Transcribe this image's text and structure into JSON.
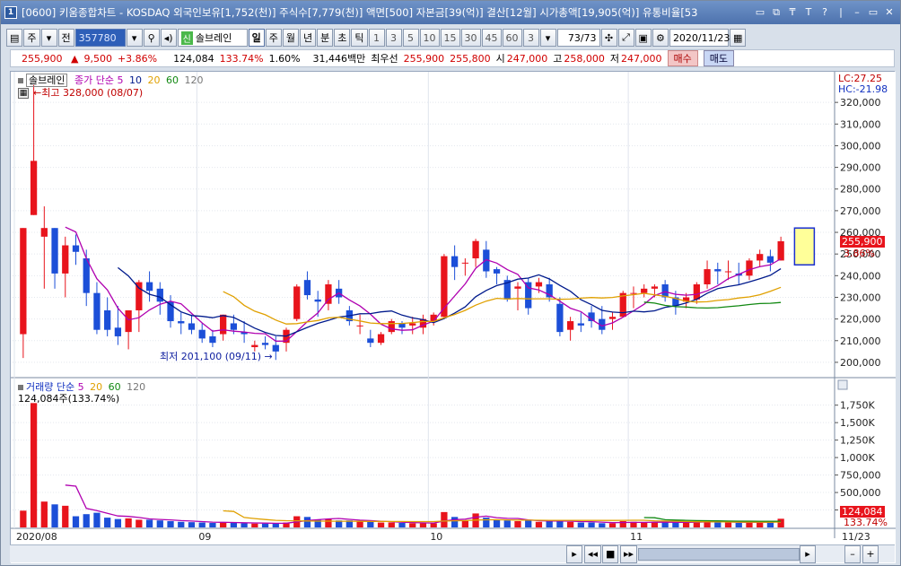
{
  "title": {
    "text": "[0600] 키움종합차트 - KOSDAQ 외국인보유[1,752(천)] 주식수[7,779(천)] 액면[500] 자본금[39(억)] 결산[12월] 시가총액[19,905(억)] 유통비율[53",
    "icon_label": "1"
  },
  "window_controls": [
    "▭",
    "⧉",
    "₸",
    "T",
    "?",
    "|",
    "–",
    "▭",
    "✕"
  ],
  "toolbar": {
    "period_label": "주",
    "prev_label": "전",
    "code": "357780",
    "search_icon": "magnifier-icon",
    "sound_icon": "speaker-icon",
    "new_tag": "신",
    "stock_name": "솔브레인",
    "periods": [
      "일",
      "주",
      "월",
      "년",
      "분",
      "초",
      "틱"
    ],
    "active_period": "일",
    "intervals": [
      "1",
      "3",
      "5",
      "10",
      "15",
      "30",
      "45",
      "60"
    ],
    "interval_value": "3",
    "count": "73",
    "count_total": "/73",
    "date": "2020/11/23"
  },
  "quote": {
    "price": "255,900",
    "arrow": "▲",
    "change": "9,500",
    "change_pct": "+3.86%",
    "volume": "124,084",
    "volume_ratio": "133.74%",
    "turnover": "1.60%",
    "amount": "31,446백만",
    "best_label": "최우선",
    "best_sell": "255,900",
    "best_buy": "255,800",
    "open_label": "시",
    "open": "247,000",
    "high_label": "고",
    "high": "258,000",
    "low_label": "저",
    "low": "247,000",
    "buy_label": "매수",
    "sell_label": "매도"
  },
  "price_panel": {
    "stock_tag": "솔브레인",
    "ma_label": "종가 단순",
    "ma_periods": [
      "5",
      "10",
      "20",
      "60",
      "120"
    ],
    "high_note": "←최고 328,000 (08/07)",
    "low_note": "최저 201,100 (09/11) →",
    "lc": "LC:27.25",
    "hc": "HC:-21.98",
    "last_price_tag": "255,900",
    "last_pct_tag": "3.86%"
  },
  "volume_panel": {
    "label": "거래량 단순",
    "ma_periods": [
      "5",
      "20",
      "60",
      "120"
    ],
    "current": "124,084주(133.74%)",
    "last_tag": "124,084",
    "last_pct_tag": "133.74%"
  },
  "x_labels": [
    "2020/08",
    "09",
    "10",
    "11",
    "11/23"
  ],
  "colors": {
    "up": "#e8141c",
    "down": "#1c4fd8",
    "ma5": "#b000b0",
    "ma10": "#001a8c",
    "ma20": "#e0a000",
    "ma60": "#118811",
    "ma120": "#555555"
  },
  "chart_data": {
    "type": "candlestick",
    "ylim": [
      195000,
      330000
    ],
    "yticks": [
      200000,
      210000,
      220000,
      230000,
      240000,
      250000,
      260000,
      270000,
      280000,
      290000,
      300000,
      310000,
      320000
    ],
    "ytick_labels": [
      "200,000",
      "210,000",
      "220,000",
      "230,000",
      "240,000",
      "250,000",
      "260,000",
      "270,000",
      "280,000",
      "290,000",
      "300,000",
      "310,000",
      "320,000"
    ],
    "volume_ylim": [
      0,
      1900000
    ],
    "volume_yticks": [
      250000,
      500000,
      750000,
      1000000,
      1250000,
      1500000,
      1750000
    ],
    "volume_ytick_labels": [
      "250,000",
      "500,000",
      "750,000",
      "1,000K",
      "1,250K",
      "1,500K",
      "1,750K"
    ],
    "candles": [
      [
        213000,
        262000,
        202000,
        262000,
        240000
      ],
      [
        268000,
        328000,
        268000,
        293000,
        1780000
      ],
      [
        258000,
        272000,
        234000,
        262000,
        370000
      ],
      [
        262000,
        262000,
        234000,
        241000,
        330000
      ],
      [
        241000,
        258000,
        230000,
        254000,
        310000
      ],
      [
        254000,
        259000,
        245000,
        251000,
        160000
      ],
      [
        248000,
        252000,
        226000,
        232000,
        190000
      ],
      [
        232000,
        237000,
        213000,
        215000,
        210000
      ],
      [
        224000,
        230000,
        212000,
        215000,
        140000
      ],
      [
        216000,
        226000,
        208000,
        212000,
        120000
      ],
      [
        214000,
        224000,
        206000,
        224000,
        130000
      ],
      [
        224000,
        238000,
        214000,
        237000,
        110000
      ],
      [
        237000,
        242000,
        228000,
        233000,
        110000
      ],
      [
        234000,
        237000,
        222000,
        228000,
        100000
      ],
      [
        228000,
        231000,
        216000,
        219000,
        90000
      ],
      [
        219000,
        223000,
        213000,
        218000,
        80000
      ],
      [
        218000,
        222000,
        213000,
        215000,
        75000
      ],
      [
        215000,
        218000,
        209000,
        211000,
        70000
      ],
      [
        212000,
        215000,
        207000,
        209000,
        65000
      ],
      [
        213000,
        222000,
        210000,
        222000,
        75000
      ],
      [
        218000,
        222000,
        213000,
        215000,
        65000
      ],
      [
        214000,
        219000,
        209000,
        213000,
        60000
      ],
      [
        207000,
        210000,
        205000,
        208000,
        55000
      ],
      [
        209000,
        212000,
        206000,
        208000,
        55000
      ],
      [
        208000,
        212000,
        201100,
        205000,
        60000
      ],
      [
        209000,
        216000,
        205000,
        215000,
        70000
      ],
      [
        220000,
        236000,
        219000,
        235000,
        160000
      ],
      [
        238000,
        242000,
        229000,
        231000,
        150000
      ],
      [
        229000,
        233000,
        221000,
        228000,
        110000
      ],
      [
        227000,
        238000,
        224000,
        236000,
        120000
      ],
      [
        234000,
        238000,
        227000,
        230000,
        100000
      ],
      [
        224000,
        226000,
        217000,
        219000,
        100000
      ],
      [
        217000,
        222000,
        213000,
        217000,
        90000
      ],
      [
        211000,
        215000,
        207000,
        209000,
        80000
      ],
      [
        209000,
        214000,
        208000,
        213000,
        70000
      ],
      [
        214000,
        220000,
        213000,
        219000,
        70000
      ],
      [
        218000,
        219000,
        213000,
        216000,
        65000
      ],
      [
        217000,
        221000,
        213000,
        218000,
        60000
      ],
      [
        216000,
        222000,
        213000,
        220000,
        60000
      ],
      [
        219000,
        223000,
        217000,
        222000,
        60000
      ],
      [
        221000,
        250000,
        220000,
        249000,
        220000
      ],
      [
        249000,
        254000,
        238000,
        244000,
        150000
      ],
      [
        246000,
        248000,
        240000,
        246000,
        100000
      ],
      [
        248000,
        257000,
        244000,
        256000,
        200000
      ],
      [
        252000,
        256000,
        239000,
        242000,
        140000
      ],
      [
        243000,
        244000,
        236000,
        241000,
        110000
      ],
      [
        238000,
        240000,
        228000,
        229000,
        100000
      ],
      [
        234000,
        237000,
        224000,
        235000,
        90000
      ],
      [
        237000,
        239000,
        222000,
        225000,
        100000
      ],
      [
        235000,
        239000,
        232000,
        237000,
        80000
      ],
      [
        236000,
        239000,
        228000,
        230000,
        90000
      ],
      [
        227000,
        230000,
        212000,
        214000,
        100000
      ],
      [
        215000,
        221000,
        210000,
        219000,
        80000
      ],
      [
        218000,
        223000,
        214000,
        217000,
        70000
      ],
      [
        223000,
        226000,
        216000,
        219000,
        70000
      ],
      [
        220000,
        226000,
        213000,
        215000,
        60000
      ],
      [
        220000,
        223000,
        215000,
        221000,
        60000
      ],
      [
        221000,
        233000,
        221000,
        232000,
        90000
      ],
      [
        232000,
        235000,
        225000,
        232000,
        80000
      ],
      [
        232000,
        236000,
        230000,
        234000,
        70000
      ],
      [
        234000,
        236000,
        230000,
        235000,
        70000
      ],
      [
        236000,
        238000,
        228000,
        230000,
        70000
      ],
      [
        230000,
        233000,
        222000,
        226000,
        75000
      ],
      [
        228000,
        232000,
        225000,
        230000,
        80000
      ],
      [
        229000,
        237000,
        227000,
        236000,
        80000
      ],
      [
        236000,
        247000,
        234000,
        243000,
        90000
      ],
      [
        243000,
        246000,
        236000,
        242000,
        70000
      ],
      [
        242000,
        247000,
        238000,
        242000,
        70000
      ],
      [
        241000,
        246000,
        236000,
        240000,
        65000
      ],
      [
        240000,
        248000,
        238000,
        247000,
        80000
      ],
      [
        247000,
        252000,
        244000,
        250000,
        90000
      ],
      [
        249000,
        252000,
        242000,
        246000,
        70000
      ],
      [
        247000,
        258000,
        247000,
        255900,
        124084
      ]
    ],
    "forecast_box": [
      245000,
      262000
    ]
  }
}
